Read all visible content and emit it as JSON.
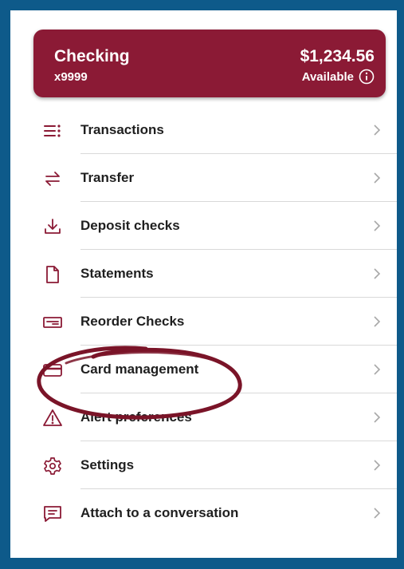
{
  "account": {
    "name": "Checking",
    "number": "x9999",
    "balance": "$1,234.56",
    "available_label": "Available"
  },
  "menu": [
    {
      "label": "Transactions",
      "icon": "list-icon"
    },
    {
      "label": "Transfer",
      "icon": "transfer-arrows-icon"
    },
    {
      "label": "Deposit checks",
      "icon": "download-tray-icon"
    },
    {
      "label": "Statements",
      "icon": "document-icon"
    },
    {
      "label": "Reorder Checks",
      "icon": "check-icon"
    },
    {
      "label": "Card management",
      "icon": "credit-card-icon"
    },
    {
      "label": "Alert preferences",
      "icon": "warning-triangle-icon"
    },
    {
      "label": "Settings",
      "icon": "gear-icon"
    },
    {
      "label": "Attach to a conversation",
      "icon": "chat-icon"
    }
  ],
  "colors": {
    "brand": "#8b1a35",
    "border": "#0e5a8a",
    "annotation": "#7a1428"
  }
}
